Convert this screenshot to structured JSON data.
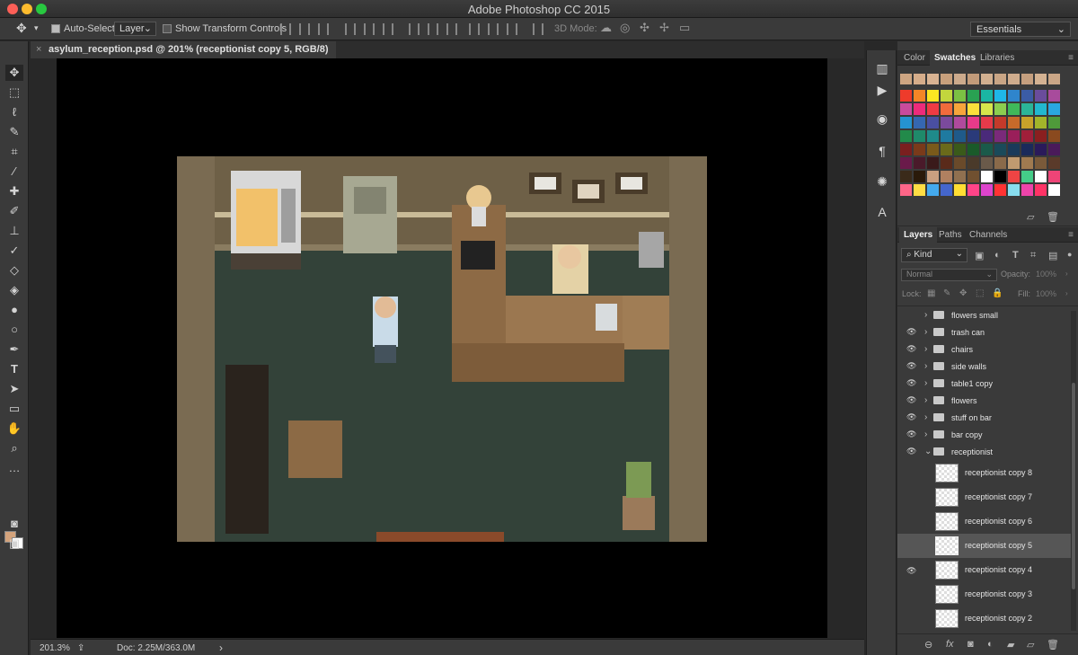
{
  "window": {
    "title": "Adobe Photoshop CC 2015"
  },
  "options_bar": {
    "auto_select_label": "Auto-Select:",
    "auto_select_value": "Layer",
    "show_transform_label": "Show Transform Controls",
    "mode_3d_label": "3D Mode:"
  },
  "workspace": {
    "value": "Essentials"
  },
  "document": {
    "tab_title": "asylum_reception.psd @ 201% (receptionist copy 5, RGB/8)",
    "close_glyph": "×"
  },
  "status": {
    "zoom": "201.3%",
    "doc": "Doc: 2.25M/363.0M",
    "arrow": "›"
  },
  "panels": {
    "top_tabs": [
      "Color",
      "Swatches",
      "Libraries"
    ],
    "top_active": "Swatches",
    "layer_tabs": [
      "Layers",
      "Paths",
      "Channels"
    ],
    "layer_active": "Layers",
    "filter_kind": "Kind",
    "blend_mode": "Normal",
    "opacity_label": "Opacity:",
    "opacity_value": "100%",
    "lock_label": "Lock:",
    "fill_label": "Fill:",
    "fill_value": "100%",
    "footer_fx": "fx"
  },
  "swatch_rows": [
    [
      "#cda582",
      "#d6ad8a",
      "#d9b392",
      "#c8a07c",
      "#ccaa8c",
      "#c29b7a",
      "#d2b090",
      "#c9a585",
      "#cfac8d",
      "#c59f7f",
      "#d4b292",
      "#caa686"
    ],
    [
      "#ee3b2b",
      "#f48626",
      "#fbe622",
      "#c2d63d",
      "#7bc043",
      "#29a152",
      "#1ab6a3",
      "#1fb7e8",
      "#2f85cc",
      "#3b5ca6",
      "#6a4c9c",
      "#a84b9c"
    ],
    [
      "#c94b9c",
      "#ed2b7b",
      "#ef3b44",
      "#f16b3b",
      "#f7a53b",
      "#fadf3b",
      "#d6e54b",
      "#8ccd4f",
      "#3fb85a",
      "#2bb598",
      "#22b8cf",
      "#2aa8e0"
    ],
    [
      "#2593d0",
      "#3567b1",
      "#4a4fa1",
      "#7b4a9c",
      "#b04a9c",
      "#e63a8a",
      "#e63a4a",
      "#c43a2a",
      "#c76a2a",
      "#c7a22a",
      "#a2b52a",
      "#4f9a3a"
    ],
    [
      "#228a4a",
      "#1f8a6a",
      "#1f8a8a",
      "#1f7aa0",
      "#1f5a8a",
      "#2a3a7a",
      "#4a2a7a",
      "#7a2a7a",
      "#9a1f5a",
      "#a01f3a",
      "#8a1f1f",
      "#8a4a1f"
    ],
    [
      "#7a1f1f",
      "#7a3a1a",
      "#7a5a1a",
      "#6a6a1a",
      "#3a5a1a",
      "#1a5a2a",
      "#1a5a4a",
      "#1a4a5a",
      "#1a3a5a",
      "#1a2a5a",
      "#2a1a5a",
      "#4a1a5a"
    ],
    [
      "#6a1a4a",
      "#4a1a2a",
      "#3a1a1a",
      "#5a2a1a",
      "#6a4a2a",
      "#4a3a2a",
      "#6a5a4a",
      "#8a6a4a",
      "#c09a70",
      "#a07a50",
      "#7a5a3a",
      "#5a3a2a"
    ],
    [
      "#3a2a1a",
      "#2a1a0a",
      "#caa080",
      "#b08060",
      "#907050",
      "#705030",
      "#ffffff",
      "#000000",
      "#ee4444",
      "#44cc88",
      "#ffffff",
      "#ee4477"
    ],
    [
      "#ff6688",
      "#ffdd44",
      "#44aaee",
      "#4466cc",
      "#ffdd33",
      "#ff4488",
      "#dd44cc",
      "#ff3333",
      "#88ddee",
      "#ee44aa",
      "#ff3366",
      "#ffffff"
    ]
  ],
  "layers": [
    {
      "name": "flowers small",
      "visible": false,
      "type": "folder"
    },
    {
      "name": "trash can",
      "visible": true,
      "type": "folder"
    },
    {
      "name": "chairs",
      "visible": true,
      "type": "folder"
    },
    {
      "name": "side walls",
      "visible": true,
      "type": "folder"
    },
    {
      "name": "table1 copy",
      "visible": true,
      "type": "folder"
    },
    {
      "name": "flowers",
      "visible": true,
      "type": "folder"
    },
    {
      "name": "stuff on bar",
      "visible": true,
      "type": "folder"
    },
    {
      "name": "bar copy",
      "visible": true,
      "type": "folder"
    },
    {
      "name": "receptionist",
      "visible": true,
      "type": "folder-open"
    },
    {
      "name": "receptionist copy 8",
      "visible": false,
      "type": "layer"
    },
    {
      "name": "receptionist copy 7",
      "visible": false,
      "type": "layer"
    },
    {
      "name": "receptionist copy 6",
      "visible": false,
      "type": "layer"
    },
    {
      "name": "receptionist copy 5",
      "visible": false,
      "type": "layer",
      "selected": true
    },
    {
      "name": "receptionist copy 4",
      "visible": true,
      "type": "layer"
    },
    {
      "name": "receptionist copy 3",
      "visible": false,
      "type": "layer"
    },
    {
      "name": "receptionist copy 2",
      "visible": false,
      "type": "layer"
    }
  ],
  "icons": {
    "move": "move-tool-icon",
    "eye": "eye-icon",
    "folder": "folder-icon"
  }
}
